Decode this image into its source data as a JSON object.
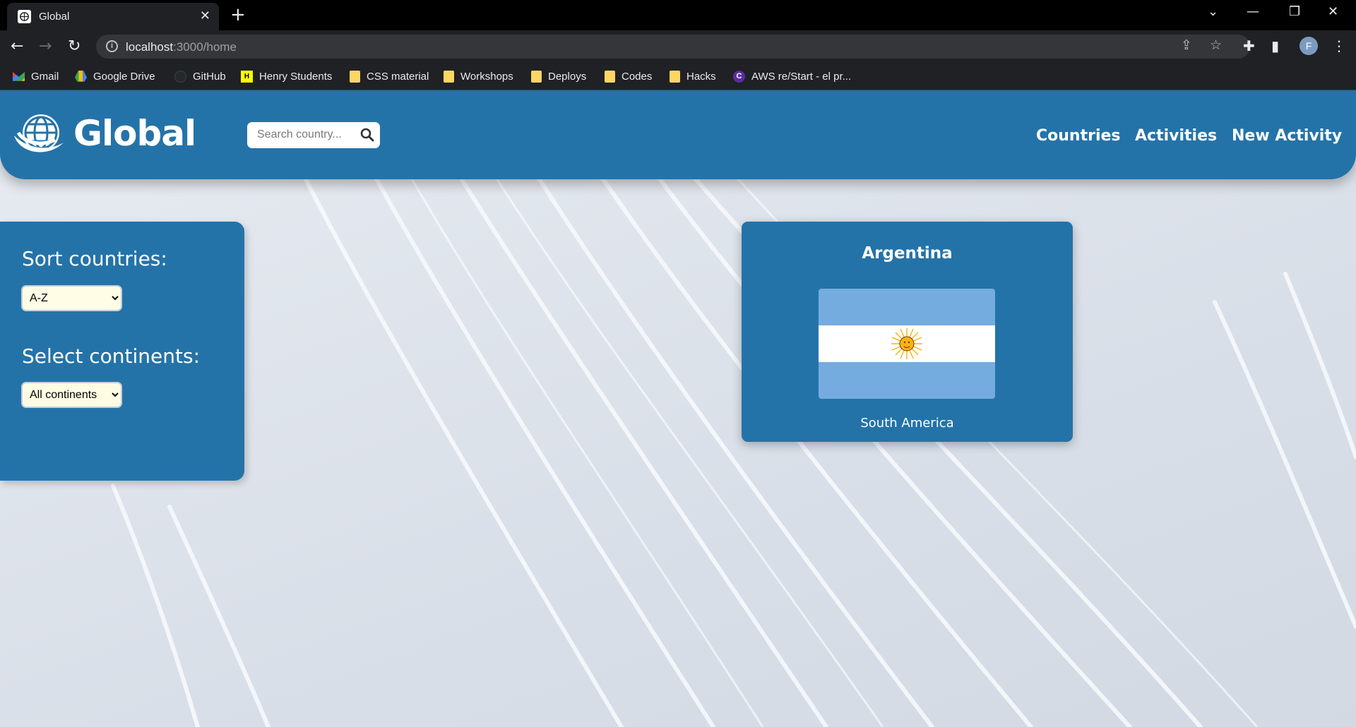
{
  "browser": {
    "tab_title": "Global",
    "tab_close": "✕",
    "new_tab": "+",
    "url_host": "localhost",
    "url_path": ":3000/home",
    "profile_initial": "F",
    "bookmarks": [
      {
        "label": "Gmail",
        "icon": "gmail-icon"
      },
      {
        "label": "Google Drive",
        "icon": "google-drive-icon"
      },
      {
        "label": "GitHub",
        "icon": "github-icon"
      },
      {
        "label": "Henry Students",
        "icon": "henry-icon"
      },
      {
        "label": "CSS material",
        "icon": "folder-icon"
      },
      {
        "label": "Workshops",
        "icon": "folder-icon"
      },
      {
        "label": "Deploys",
        "icon": "folder-icon"
      },
      {
        "label": "Codes",
        "icon": "folder-icon"
      },
      {
        "label": "Hacks",
        "icon": "folder-icon"
      },
      {
        "label": "AWS re/Start - el pr...",
        "icon": "aws-icon"
      }
    ]
  },
  "header": {
    "logo_text": "Global",
    "search_placeholder": "Search country...",
    "nav": [
      "Countries",
      "Activities",
      "New Activity"
    ]
  },
  "sidebar": {
    "sort_label": "Sort countries:",
    "sort_selected": "A-Z",
    "continent_label": "Select continents:",
    "continent_selected": "All continents"
  },
  "cards": [
    {
      "name": "Argentina",
      "continent": "South America",
      "flag_colors": [
        "#74acdf",
        "#ffffff",
        "#74acdf"
      ],
      "sun_color": "#f6b40e"
    }
  ],
  "colors": {
    "primary": "#2473a8",
    "background": "#dde2ea"
  }
}
